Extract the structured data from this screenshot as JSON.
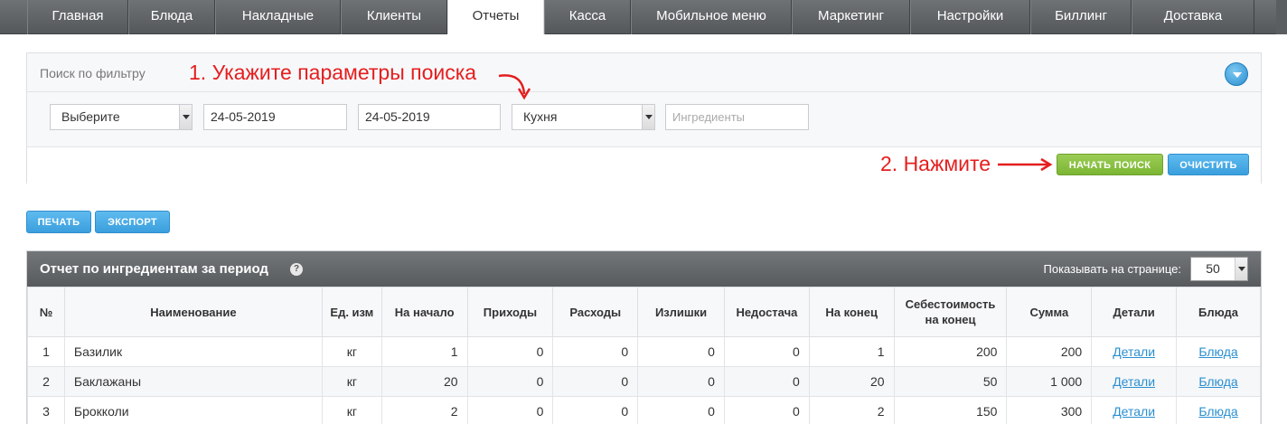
{
  "nav": {
    "tabs": [
      {
        "label": "Главная"
      },
      {
        "label": "Блюда"
      },
      {
        "label": "Накладные"
      },
      {
        "label": "Клиенты"
      },
      {
        "label": "Отчеты",
        "active": true
      },
      {
        "label": "Касса"
      },
      {
        "label": "Мобильное меню"
      },
      {
        "label": "Маркетинг"
      },
      {
        "label": "Настройки"
      },
      {
        "label": "Биллинг"
      },
      {
        "label": "Доставка"
      }
    ]
  },
  "filter": {
    "title": "Поиск по фильтру",
    "select_type": "Выберите",
    "date_from": "24-05-2019",
    "date_to": "24-05-2019",
    "select_place": "Кухня",
    "ingredients_placeholder": "Ингредиенты",
    "search_button": "НАЧАТЬ ПОИСК",
    "clear_button": "ОЧИСТИТЬ"
  },
  "annotations": {
    "step1": "1. Укажите параметры поиска",
    "step2": "2. Нажмите"
  },
  "actions": {
    "print_button": "ПЕЧАТЬ",
    "export_button": "ЭКСПОРТ"
  },
  "report": {
    "title": "Отчет по ингредиентам за период",
    "help_icon_glyph": "?",
    "per_page_label": "Показывать на странице:",
    "per_page_value": "50",
    "columns": [
      "№",
      "Наименование",
      "Ед. изм",
      "На начало",
      "Приходы",
      "Расходы",
      "Излишки",
      "Недостача",
      "На конец",
      "Себестоимость на конец",
      "Сумма",
      "Детали",
      "Блюда"
    ],
    "rows": [
      {
        "num": "1",
        "name": "Базилик",
        "unit": "кг",
        "start": "1",
        "income": "0",
        "expense": "0",
        "surplus": "0",
        "shortage": "0",
        "end": "1",
        "cost": "200",
        "sum": "200",
        "details": "Детали",
        "dishes": "Блюда"
      },
      {
        "num": "2",
        "name": "Баклажаны",
        "unit": "кг",
        "start": "20",
        "income": "0",
        "expense": "0",
        "surplus": "0",
        "shortage": "0",
        "end": "20",
        "cost": "50",
        "sum": "1 000",
        "details": "Детали",
        "dishes": "Блюда"
      },
      {
        "num": "3",
        "name": "Брокколи",
        "unit": "кг",
        "start": "2",
        "income": "0",
        "expense": "0",
        "surplus": "0",
        "shortage": "0",
        "end": "2",
        "cost": "150",
        "sum": "300",
        "details": "Детали",
        "dishes": "Блюда"
      }
    ]
  },
  "colors": {
    "nav_bg": "#616467",
    "accent_blue": "#3a9fdd",
    "accent_green": "#7cb534",
    "annotation_red": "#e51e1e"
  }
}
